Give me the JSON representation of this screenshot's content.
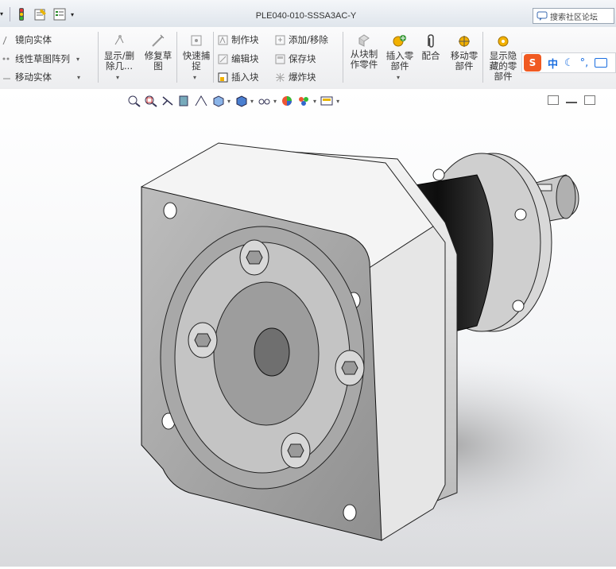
{
  "window": {
    "title": "PLE040-010-SSSA3AC-Y"
  },
  "search": {
    "label": "搜索社区论坛"
  },
  "ribbon": {
    "sketch_group": {
      "mirror_entities": "镜向实体",
      "linear_sketch_pattern": "线性草图阵列",
      "move_entities": "移动实体"
    },
    "display_delete": [
      "显示/删",
      "除几..."
    ],
    "repair_sketch": [
      "修复草",
      "图"
    ],
    "quick_snaps": [
      "快速捕",
      "捉"
    ],
    "blocks": {
      "make_block": "制作块",
      "edit_block": "编辑块",
      "insert_block": "插入块",
      "add_remove": "添加/移除",
      "save_block": "保存块",
      "explode_block": "爆炸块"
    },
    "assembly": {
      "from_block_part": [
        "从块制",
        "作零件"
      ],
      "insert_components": [
        "插入零",
        "部件"
      ],
      "mate": "配合",
      "move_component": [
        "移动零",
        "部件"
      ],
      "show_hidden": [
        "显示隐",
        "藏的零",
        "部件"
      ]
    }
  },
  "ime": {
    "brand": "S",
    "mode": "中"
  },
  "model": {
    "part": "planetary gearbox flange",
    "colors": {
      "flange": "#cfcfcf",
      "body": "#1c1c1c",
      "shaft": "#bdbdbd"
    }
  }
}
